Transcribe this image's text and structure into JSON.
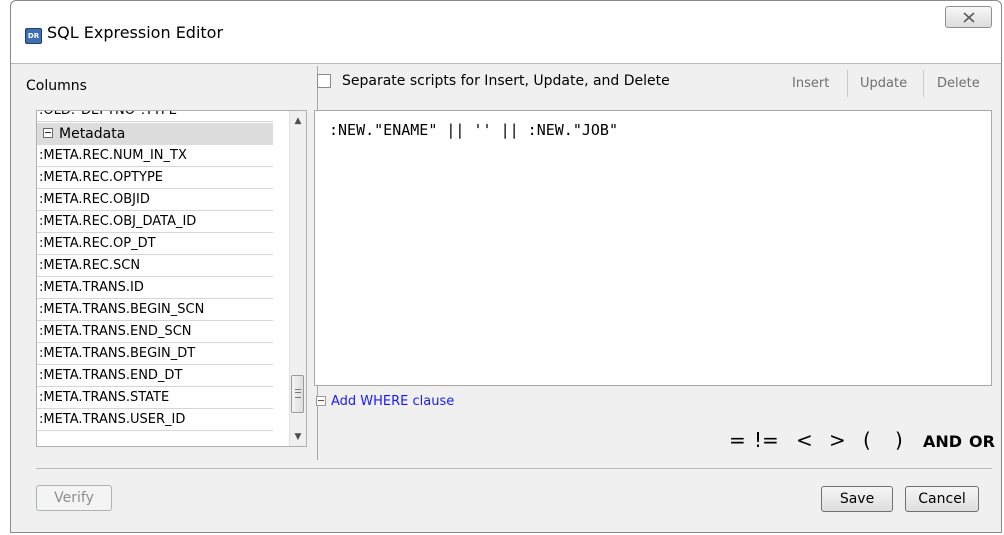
{
  "window": {
    "title": "SQL Expression Editor",
    "app_icon_text": "DR"
  },
  "columns": {
    "label": "Columns",
    "partial_item": ":OLD.\"DEPTNO\".TYPE",
    "group_label": "Metadata",
    "items": [
      ":META.REC.NUM_IN_TX",
      ":META.REC.OPTYPE",
      ":META.REC.OBJID",
      ":META.REC.OBJ_DATA_ID",
      ":META.REC.OP_DT",
      ":META.REC.SCN",
      ":META.TRANS.ID",
      ":META.TRANS.BEGIN_SCN",
      ":META.TRANS.END_SCN",
      ":META.TRANS.BEGIN_DT",
      ":META.TRANS.END_DT",
      ":META.TRANS.STATE",
      ":META.TRANS.USER_ID"
    ]
  },
  "scripts": {
    "separate_label": "Separate scripts for Insert, Update, and Delete",
    "separate_checked": false,
    "tabs": [
      "Insert",
      "Update",
      "Delete"
    ]
  },
  "editor": {
    "text": ":NEW.\"ENAME\" || '' || :NEW.\"JOB\""
  },
  "where_link": "Add WHERE clause",
  "operators": [
    "=",
    "!=",
    "<",
    ">",
    "(",
    ")",
    "AND",
    "OR"
  ],
  "buttons": {
    "verify": "Verify",
    "save": "Save",
    "cancel": "Cancel"
  }
}
